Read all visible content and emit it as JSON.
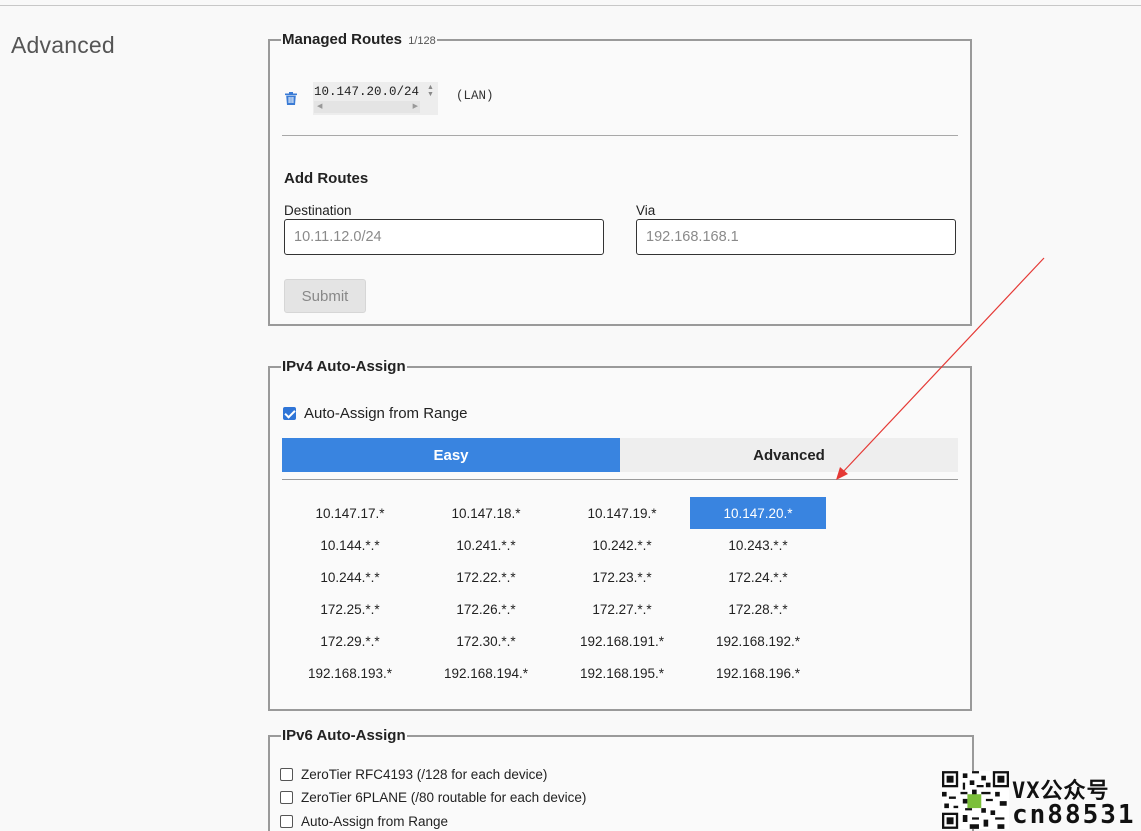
{
  "section": {
    "title": "Advanced"
  },
  "managed_routes": {
    "legend": "Managed Routes",
    "count": "1/128",
    "routes": [
      {
        "target": "10.147.20.0/24",
        "via": "(LAN)"
      }
    ]
  },
  "add_routes": {
    "title": "Add Routes",
    "destination_label": "Destination",
    "destination_placeholder": "10.11.12.0/24",
    "via_label": "Via",
    "via_placeholder": "192.168.168.1",
    "submit_label": "Submit"
  },
  "ipv4": {
    "legend": "IPv4 Auto-Assign",
    "auto_assign_label": "Auto-Assign from Range",
    "auto_assign_checked": true,
    "tabs": [
      {
        "label": "Easy",
        "active": true
      },
      {
        "label": "Advanced",
        "active": false
      }
    ],
    "ranges": [
      "10.147.17.*",
      "10.147.18.*",
      "10.147.19.*",
      "10.147.20.*",
      "10.144.*.*",
      "10.241.*.*",
      "10.242.*.*",
      "10.243.*.*",
      "10.244.*.*",
      "172.22.*.*",
      "172.23.*.*",
      "172.24.*.*",
      "172.25.*.*",
      "172.26.*.*",
      "172.27.*.*",
      "172.28.*.*",
      "172.29.*.*",
      "172.30.*.*",
      "192.168.191.*",
      "192.168.192.*",
      "192.168.193.*",
      "192.168.194.*",
      "192.168.195.*",
      "192.168.196.*"
    ],
    "selected_range": "10.147.20.*"
  },
  "ipv6": {
    "legend": "IPv6 Auto-Assign",
    "options": [
      {
        "label": "ZeroTier RFC4193 (/128 for each device)",
        "checked": false
      },
      {
        "label": "ZeroTier 6PLANE (/80 routable for each device)",
        "checked": false
      },
      {
        "label": "Auto-Assign from Range",
        "checked": false
      }
    ]
  },
  "watermark": {
    "line1": "VX公众号",
    "line2": "cn88531"
  },
  "colors": {
    "accent": "#3984e0",
    "annotation_arrow": "#e53935"
  }
}
